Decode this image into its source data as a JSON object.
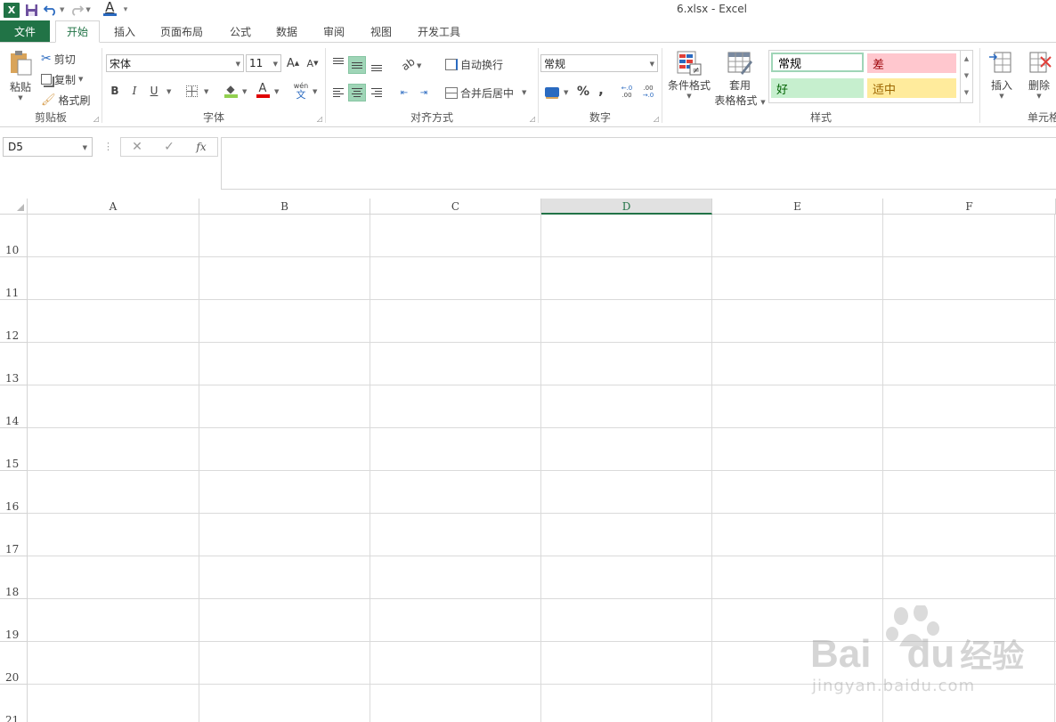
{
  "window": {
    "title": "6.xlsx - Excel"
  },
  "qat": {
    "logo": "X",
    "font_color_letter": "A"
  },
  "tabs": [
    {
      "label": "开始",
      "active": true
    },
    {
      "label": "插入"
    },
    {
      "label": "页面布局"
    },
    {
      "label": "公式"
    },
    {
      "label": "数据"
    },
    {
      "label": "审阅"
    },
    {
      "label": "视图"
    },
    {
      "label": "开发工具"
    }
  ],
  "file_tab": "文件",
  "ribbon": {
    "clipboard": {
      "label": "剪贴板",
      "paste": "粘贴",
      "cut": "剪切",
      "copy": "复制",
      "format_painter": "格式刷"
    },
    "font": {
      "label": "字体",
      "font_name": "宋体",
      "font_size": "11",
      "bold": "B",
      "italic": "I",
      "underline": "U",
      "grow": "A",
      "shrink": "A",
      "font_color": "A",
      "phonetic": "wén",
      "phonetic_char": "文"
    },
    "alignment": {
      "label": "对齐方式",
      "wrap_text": "自动换行",
      "merge_center": "合并后居中"
    },
    "number": {
      "label": "数字",
      "format": "常规",
      "percent": "%",
      "comma": ",",
      "inc_dec": ".00",
      "dec_dec": ".00"
    },
    "styles": {
      "label": "样式",
      "conditional_format": "条件格式",
      "table_format_line1": "套用",
      "table_format_line2": "表格格式",
      "normal": "常规",
      "bad": "差",
      "good": "好",
      "neutral": "适中"
    },
    "cells": {
      "label": "单元格",
      "insert": "插入",
      "delete": "删除"
    }
  },
  "formula_bar": {
    "name_box": "D5",
    "fx": "fx",
    "cancel": "✕",
    "enter": "✓",
    "content": ""
  },
  "grid": {
    "columns": [
      "A",
      "B",
      "C",
      "D",
      "E",
      "F"
    ],
    "selected_column": "D",
    "rows": [
      "10",
      "11",
      "12",
      "13",
      "14",
      "15",
      "16",
      "17",
      "18",
      "19",
      "20",
      "21"
    ]
  },
  "watermark": {
    "brand": "Bai",
    "brand2": "du",
    "cn": "经验",
    "url": "jingyan.baidu.com"
  },
  "colors": {
    "excel_green": "#217346",
    "selected_fill": "#9fd5b7",
    "good_fill": "#c6efce",
    "bad_fill": "#ffc7ce",
    "neutral_fill": "#ffeb9c"
  }
}
